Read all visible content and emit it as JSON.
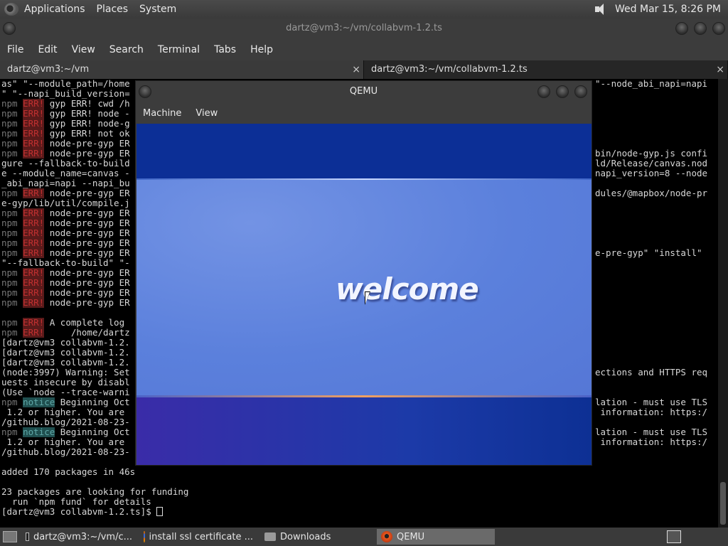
{
  "top_panel": {
    "menus": [
      "Applications",
      "Places",
      "System"
    ],
    "clock": "Wed Mar 15,  8:26 PM"
  },
  "terminal": {
    "title": "dartz@vm3:~/vm/collabvm-1.2.ts",
    "menus": [
      "File",
      "Edit",
      "View",
      "Search",
      "Terminal",
      "Tabs",
      "Help"
    ],
    "tabs": [
      {
        "label": "dartz@vm3:~/vm",
        "close": "×"
      },
      {
        "label": "dartz@vm3:~/vm/collabvm-1.2.ts",
        "close": "×"
      }
    ],
    "lines": [
      {
        "left": "as\" \"--module_path=/home",
        "right": "\"--node_abi_napi=napi"
      },
      {
        "left": "\" \"--napi_build_version=",
        "right": ""
      },
      {
        "tag": "err",
        "pre": "npm",
        "left": " gyp ERR! cwd /h",
        "right": ""
      },
      {
        "tag": "err",
        "pre": "npm",
        "left": " gyp ERR! node -",
        "right": ""
      },
      {
        "tag": "err",
        "pre": "npm",
        "left": " gyp ERR! node-g",
        "right": ""
      },
      {
        "tag": "err",
        "pre": "npm",
        "left": " gyp ERR! not ok",
        "right": ""
      },
      {
        "tag": "err",
        "pre": "npm",
        "left": " node-pre-gyp ER",
        "right": ""
      },
      {
        "tag": "err",
        "pre": "npm",
        "left": " node-pre-gyp ER",
        "right": "bin/node-gyp.js confi"
      },
      {
        "left": "gure --fallback-to-build",
        "right": "ld/Release/canvas.nod"
      },
      {
        "left": "e --module_name=canvas -",
        "right": "napi_version=8 --node"
      },
      {
        "left": "_abi_napi=napi --napi_bu",
        "right": ""
      },
      {
        "tag": "err",
        "pre": "npm",
        "left": " node-pre-gyp ER",
        "right": "dules/@mapbox/node-pr"
      },
      {
        "left": "e-gyp/lib/util/compile.j",
        "right": ""
      },
      {
        "tag": "err",
        "pre": "npm",
        "left": " node-pre-gyp ER",
        "right": ""
      },
      {
        "tag": "err",
        "pre": "npm",
        "left": " node-pre-gyp ER",
        "right": ""
      },
      {
        "tag": "err",
        "pre": "npm",
        "left": " node-pre-gyp ER",
        "right": ""
      },
      {
        "tag": "err",
        "pre": "npm",
        "left": " node-pre-gyp ER",
        "right": ""
      },
      {
        "tag": "err",
        "pre": "npm",
        "left": " node-pre-gyp ER",
        "right": "e-pre-gyp\" \"install\""
      },
      {
        "left": "\"--fallback-to-build\" \"-",
        "right": ""
      },
      {
        "tag": "err",
        "pre": "npm",
        "left": " node-pre-gyp ER",
        "right": ""
      },
      {
        "tag": "err",
        "pre": "npm",
        "left": " node-pre-gyp ER",
        "right": ""
      },
      {
        "tag": "err",
        "pre": "npm",
        "left": " node-pre-gyp ER",
        "right": ""
      },
      {
        "tag": "err",
        "pre": "npm",
        "left": " node-pre-gyp ER",
        "right": ""
      },
      {
        "left": "",
        "right": ""
      },
      {
        "tag": "err",
        "pre": "npm",
        "left": " A complete log",
        "right": ""
      },
      {
        "tag": "err",
        "pre": "npm",
        "left": "     /home/dartz",
        "right": ""
      },
      {
        "left": "[dartz@vm3 collabvm-1.2.",
        "right": ""
      },
      {
        "left": "[dartz@vm3 collabvm-1.2.",
        "right": ""
      },
      {
        "left": "[dartz@vm3 collabvm-1.2.",
        "right": ""
      },
      {
        "left": "(node:3997) Warning: Set",
        "right": "ections and HTTPS req"
      },
      {
        "left": "uests insecure by disabl",
        "right": ""
      },
      {
        "left": "(Use `node --trace-warni",
        "right": ""
      },
      {
        "tag": "notice",
        "pre": "npm",
        "left": " Beginning Oct",
        "right": "lation - must use TLS"
      },
      {
        "left": " 1.2 or higher. You are",
        "right": " information: https:/"
      },
      {
        "left": "/github.blog/2021-08-23-",
        "right": ""
      },
      {
        "tag": "notice",
        "pre": "npm",
        "left": " Beginning Oct",
        "right": "lation - must use TLS"
      },
      {
        "left": " 1.2 or higher. You are",
        "right": " information: https:/"
      },
      {
        "left": "/github.blog/2021-08-23-",
        "right": ""
      },
      {
        "left": "",
        "right": ""
      },
      {
        "left": "added 170 packages in 46s",
        "right": ""
      },
      {
        "left": "",
        "right": ""
      },
      {
        "left": "23 packages are looking for funding",
        "right": ""
      },
      {
        "left": "  run `npm fund` for details",
        "right": ""
      },
      {
        "left": "[dartz@vm3 collabvm-1.2.ts]$ ",
        "right": "",
        "cursor": true
      }
    ],
    "err_badge": "ERR!",
    "notice_badge": "notice"
  },
  "qemu": {
    "title": "QEMU",
    "menus": [
      "Machine",
      "View"
    ],
    "screen_text": "welcome"
  },
  "taskbar": {
    "items": [
      {
        "label": "dartz@vm3:~/vm/c...",
        "icon": "terminal-icon"
      },
      {
        "label": "install ssl certificate ...",
        "icon": "firefox-icon"
      },
      {
        "label": "Downloads",
        "icon": "folder-icon"
      },
      {
        "label": "QEMU",
        "icon": "qemu-icon",
        "active": true
      }
    ]
  }
}
